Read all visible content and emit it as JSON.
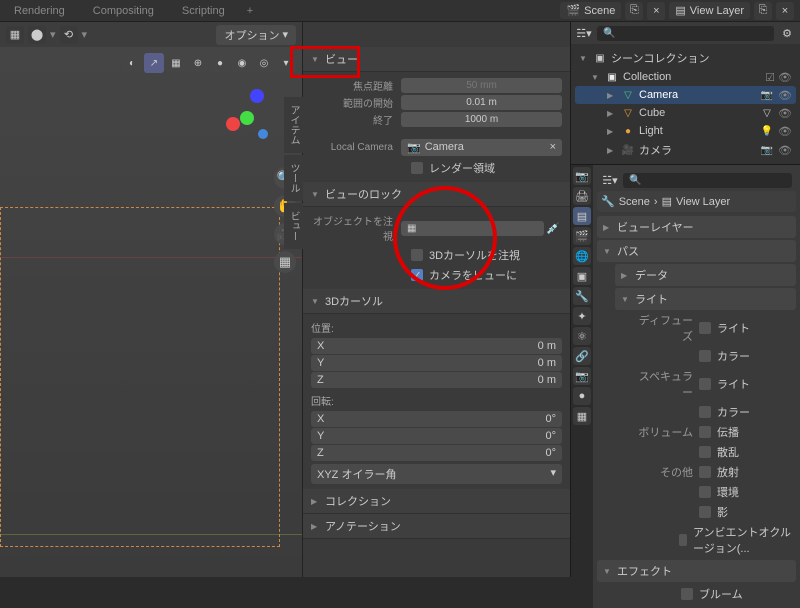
{
  "top_tabs": [
    "Rendering",
    "Compositing",
    "Scripting"
  ],
  "scene": {
    "label": "Scene",
    "viewlayer": "View Layer"
  },
  "viewport": {
    "options": "オプション"
  },
  "npanel": {
    "view": {
      "title": "ビュー",
      "focal_label": "焦点距離",
      "focal": "50 mm",
      "clip_start_label": "範囲の開始",
      "clip_start": "0.01 m",
      "clip_end_label": "終了",
      "clip_end": "1000 m",
      "local_camera_label": "Local Camera",
      "local_camera": "Camera",
      "render_region": "レンダー領域"
    },
    "lock": {
      "title": "ビューのロック",
      "obj_label": "オブジェクトを注視",
      "lock_3dcursor": "3Dカーソルを注視",
      "lock_camera": "カメラをビューに"
    },
    "cursor": {
      "title": "3Dカーソル",
      "loc": "位置:",
      "rot": "回転:",
      "x": "X",
      "y": "Y",
      "z": "Z",
      "loc_val": "0 m",
      "rot_val": "0°",
      "euler": "XYZ オイラー角"
    },
    "collections": "コレクション",
    "annotation": "アノテーション"
  },
  "side_tabs": [
    "アイテム",
    "ツール",
    "ビュー"
  ],
  "outliner": {
    "root": "シーンコレクション",
    "collection": "Collection",
    "items": [
      {
        "n": "Camera",
        "c": "#4ec478"
      },
      {
        "n": "Cube",
        "c": "#e8a23a"
      },
      {
        "n": "Light",
        "c": "#e8a23a"
      },
      {
        "n": "カメラ",
        "c": "#e8a23a"
      }
    ]
  },
  "props": {
    "scene": "Scene",
    "viewlayer": "View Layer",
    "sec_viewlayer": "ビューレイヤー",
    "sec_pass": "パス",
    "sec_data": "データ",
    "sec_light": "ライト",
    "diffuse": "ディフューズ",
    "specular": "スペキュラー",
    "volume": "ボリューム",
    "other": "その他",
    "light_c": "ライト",
    "color": "カラー",
    "transmission": "伝播",
    "scatter": "散乱",
    "emit": "放射",
    "env": "環境",
    "shadow": "影",
    "ao": "アンビエントオクルージョン(...",
    "sec_effect": "エフェクト",
    "bloom": "ブルーム"
  }
}
